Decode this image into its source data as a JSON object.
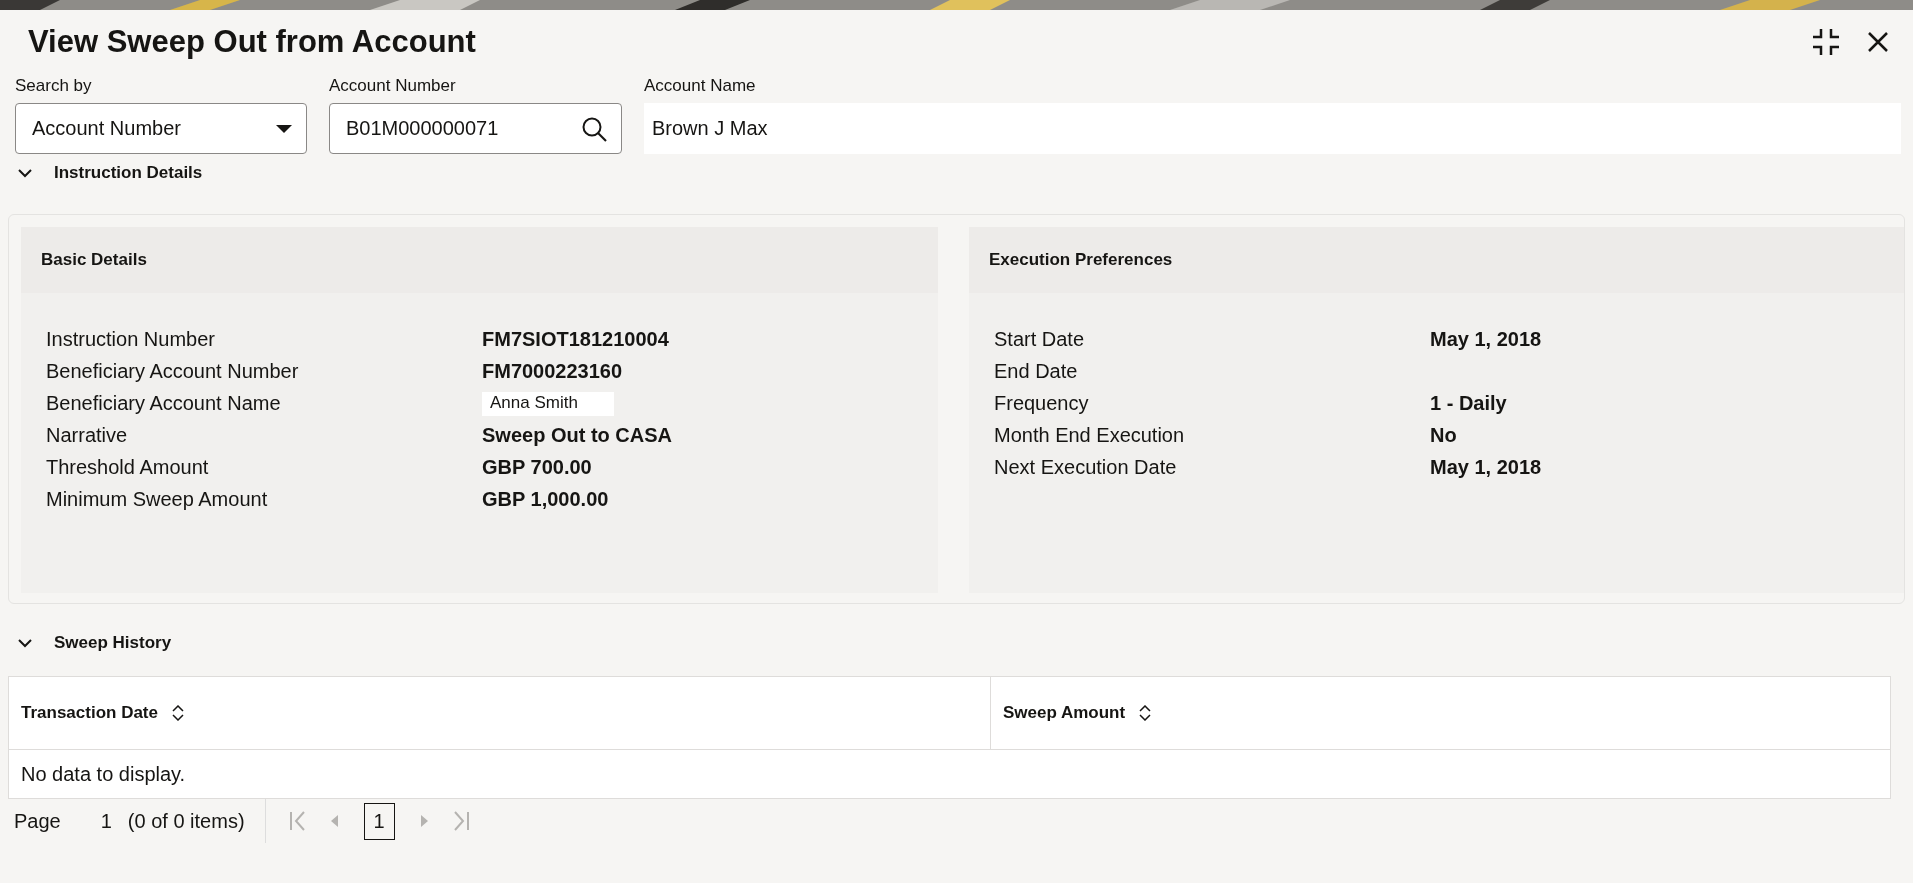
{
  "title": "View Sweep Out from Account",
  "search": {
    "fields": [
      {
        "label": "Search by",
        "kind": "select",
        "value": "Account Number"
      },
      {
        "label": "Account Number",
        "kind": "search",
        "value": "B01M000000071"
      },
      {
        "label": "Account Name",
        "kind": "readonly",
        "value": "Brown J Max"
      }
    ]
  },
  "instruction_details": {
    "title": "Instruction Details",
    "expanded": true,
    "cards": [
      {
        "title": "Basic Details",
        "rows": [
          {
            "label": "Instruction Number",
            "value": "FM7SIOT181210004",
            "kind": "bold"
          },
          {
            "label": "Beneficiary Account Number",
            "value": "FM7000223160",
            "kind": "bold"
          },
          {
            "label": "Beneficiary Account Name",
            "value": "Anna Smith",
            "kind": "boxed"
          },
          {
            "label": "Narrative",
            "value": "Sweep Out to CASA",
            "kind": "bold"
          },
          {
            "label": "Threshold Amount",
            "value": "GBP 700.00",
            "kind": "bold"
          },
          {
            "label": "Minimum Sweep Amount",
            "value": "GBP 1,000.00",
            "kind": "bold"
          }
        ]
      },
      {
        "title": "Execution Preferences",
        "rows": [
          {
            "label": "Start Date",
            "value": "May 1, 2018",
            "kind": "bold"
          },
          {
            "label": "End Date"
          },
          {
            "label": "Frequency",
            "value": "1 - Daily",
            "kind": "bold"
          },
          {
            "label": "Month End Execution",
            "value": "No",
            "kind": "bold"
          },
          {
            "label": "Next Execution Date",
            "value": "May 1, 2018",
            "kind": "bold"
          }
        ]
      }
    ]
  },
  "sweep_history": {
    "title": "Sweep History",
    "expanded": true,
    "table": {
      "columns": [
        "Transaction Date",
        "Sweep Amount"
      ],
      "empty_message": "No data to display."
    },
    "pagination": {
      "page_label": "Page",
      "page": "1",
      "summary": "(0 of 0 items)",
      "pages": [
        {
          "label": "1",
          "selected": true
        }
      ],
      "first_disabled": true,
      "prev_disabled": true,
      "next_disabled": true,
      "last_disabled": true
    }
  }
}
